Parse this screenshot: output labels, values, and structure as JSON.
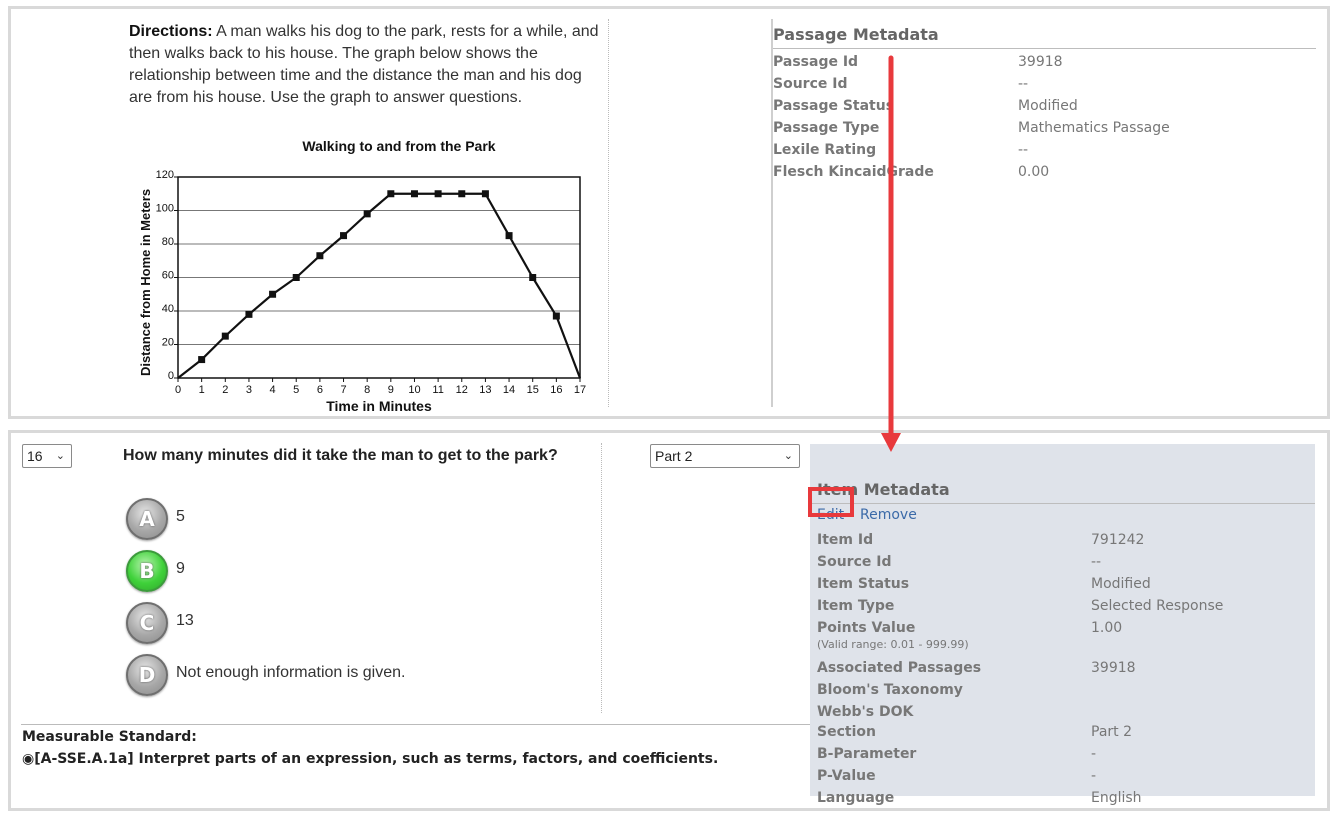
{
  "passage": {
    "directions_label": "Directions:",
    "directions_text": "A man walks his dog to the park, rests for a while, and then walks back to his house. The graph below shows the relationship between time and the distance the man and his dog are from his house. Use the graph to answer questions."
  },
  "chart_data": {
    "type": "line",
    "title": "Walking to and from the Park",
    "xlabel": "Time in Minutes",
    "ylabel": "Distance from Home in Meters",
    "xlim": [
      0,
      17
    ],
    "ylim": [
      0,
      120
    ],
    "x_ticks": [
      "0",
      "1",
      "2",
      "3",
      "4",
      "5",
      "6",
      "7",
      "8",
      "9",
      "10",
      "11",
      "12",
      "13",
      "14",
      "15",
      "16",
      "17"
    ],
    "y_ticks": [
      "0",
      "20",
      "40",
      "60",
      "80",
      "100",
      "120"
    ],
    "grid": "horizontal",
    "series": [
      {
        "x": [
          0,
          1,
          2,
          3,
          4,
          5,
          6,
          7,
          8,
          9,
          10,
          11,
          12,
          13,
          14,
          15,
          16,
          17
        ],
        "y": [
          0,
          11,
          25,
          38,
          50,
          60,
          73,
          85,
          98,
          110,
          110,
          110,
          110,
          110,
          85,
          60,
          37,
          0
        ]
      }
    ]
  },
  "passage_meta": {
    "title": "Passage Metadata",
    "rows": [
      {
        "k": "Passage Id",
        "v": "39918"
      },
      {
        "k": "Source Id",
        "v": "--"
      },
      {
        "k": "Passage Status",
        "v": "Modified"
      },
      {
        "k": "Passage Type",
        "v": "Mathematics Passage"
      },
      {
        "k": "Lexile Rating",
        "v": "--"
      },
      {
        "k": "Flesch KincaidGrade",
        "v": "0.00"
      }
    ]
  },
  "item": {
    "number_select": "16",
    "part_select": "Part 2",
    "question": "How many minutes did it take the man to get to the park?",
    "choices": [
      {
        "letter": "A",
        "text": "5",
        "correct": false
      },
      {
        "letter": "B",
        "text": "9",
        "correct": true
      },
      {
        "letter": "C",
        "text": "13",
        "correct": false
      },
      {
        "letter": "D",
        "text": "Not enough information is given.",
        "correct": false
      }
    ],
    "standard_title": "Measurable Standard:",
    "standard_text": "[A-SSE.A.1a] Interpret parts of an expression, such as terms, factors, and coefficients."
  },
  "item_meta": {
    "title": "Item Metadata",
    "edit_label": "Edit",
    "remove_label": "Remove",
    "valid_range": "(Valid range: 0.01 - 999.99)",
    "rows": [
      {
        "k": "Item Id",
        "v": "791242"
      },
      {
        "k": "Source Id",
        "v": "--"
      },
      {
        "k": "Item Status",
        "v": "Modified"
      },
      {
        "k": "Item Type",
        "v": "Selected Response"
      },
      {
        "k": "Points Value",
        "v": "1.00"
      },
      {
        "k": "Associated Passages",
        "v": "39918"
      },
      {
        "k": "Bloom's Taxonomy",
        "v": ""
      },
      {
        "k": "Webb's DOK",
        "v": ""
      },
      {
        "k": "Section",
        "v": "Part 2"
      },
      {
        "k": "B-Parameter",
        "v": "-"
      },
      {
        "k": "P-Value",
        "v": "-"
      },
      {
        "k": "Language",
        "v": "English"
      }
    ]
  },
  "colors": {
    "highlight": "#e8393c",
    "link": "#3b6aa8",
    "meta_panel_bg": "#dfe3ea",
    "correct_green": "#3fd13a"
  }
}
